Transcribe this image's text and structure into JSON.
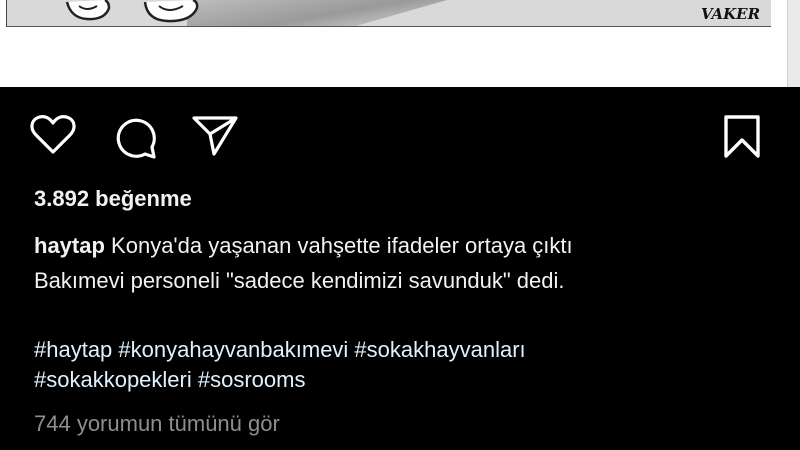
{
  "post": {
    "signature": "VAKER",
    "likes_text": "3.892 beğenme",
    "username": "haytap",
    "caption_line1": "Konya'da yaşanan vahşette ifadeler ortaya çıktı",
    "caption_line2": "Bakımevi personeli \"sadece kendimizi savunduk\" dedi.",
    "hashtags_line1": "#haytap #konyahayvanbakımevi #sokakhayvanları",
    "hashtags_line2": "#sokakkopekleri #sosrooms",
    "view_comments": "744 yorumun tümünü gör"
  },
  "icons": {
    "like": "heart-icon",
    "comment": "comment-bubble-icon",
    "share": "paper-plane-icon",
    "save": "bookmark-icon"
  },
  "colors": {
    "background": "#000000",
    "text": "#f2f2f2",
    "hashtag": "#e0f1ff",
    "muted": "#8e8e8e"
  }
}
